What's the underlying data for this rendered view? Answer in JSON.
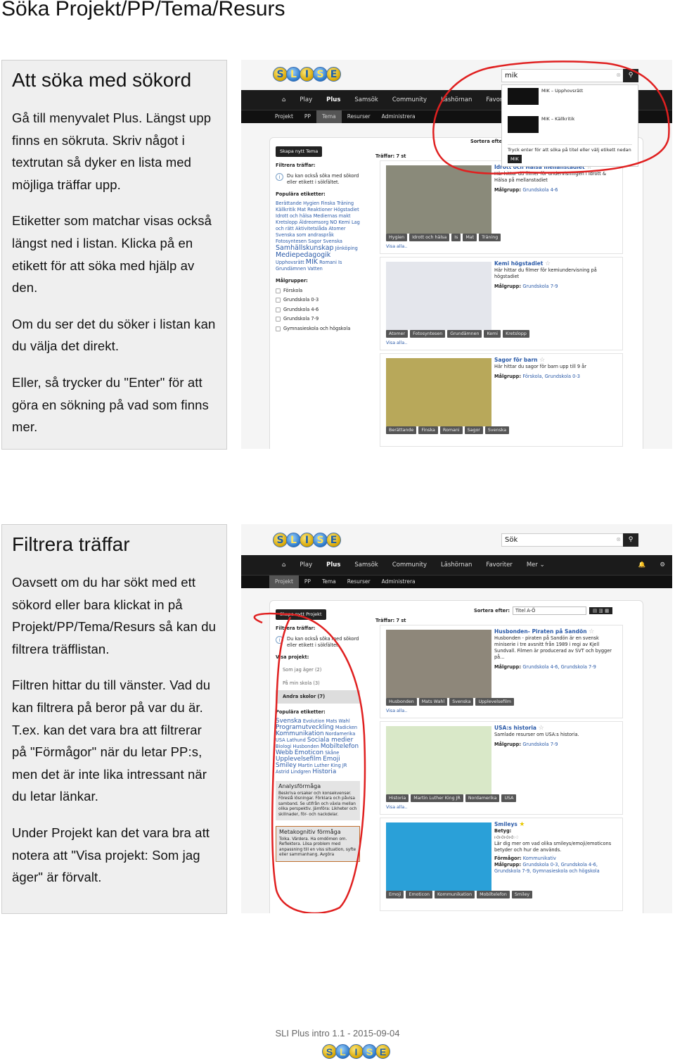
{
  "page_title": "Söka Projekt/PP/Tema/Resurs",
  "section1": {
    "heading": "Att söka med sökord",
    "paragraphs": [
      "Gå till menyvalet Plus. Längst upp finns en sökruta. Skriv något i textrutan så dyker en lista med möjliga träffar upp.",
      "Etiketter som matchar visas också längst ned i listan. Klicka på en etikett för att söka med hjälp av den.",
      "Om du ser det du söker i listan kan du välja det direkt.",
      "Eller, så trycker du \"Enter\" för att göra en sökning på vad som finns mer."
    ]
  },
  "section2": {
    "heading": "Filtrera träffar",
    "paragraphs": [
      "Oavsett om du har sökt med ett sökord eller bara klickat in på Projekt/PP/Tema/Resurs så kan du filtrera träfflistan.",
      "Filtren hittar du till vänster. Vad du kan filtrera på beror på var du är. T.ex. kan det vara bra att filtrerar på \"Förmågor\" när du letar PP:s, men det är inte lika intressant när du letar länkar.",
      "Under Projekt kan det vara bra att notera att \"Visa projekt: Som jag äger\" är förvalt."
    ]
  },
  "logo_letters": [
    "S",
    "L",
    "I",
    "S",
    "E"
  ],
  "nav": {
    "main": [
      "Play",
      "Plus",
      "Samsök",
      "Community",
      "Läshörnan",
      "Favoriter",
      "Mer ⌄"
    ],
    "active": "Plus",
    "sub": [
      "Projekt",
      "PP",
      "Tema",
      "Resurser",
      "Administrera"
    ]
  },
  "shot1": {
    "search_value": "mik",
    "active_sub": "Tema",
    "create_button": "Skapa nytt Tema",
    "dropdown": {
      "items": [
        "MIK – Upphovsrätt",
        "MIK – Källkritik"
      ],
      "hint": "Tryck enter för att söka på titel eller välj etikett nedan",
      "tag": "MIK"
    },
    "sort_label": "Sortera efter:",
    "filter_title": "Filtrera träffar:",
    "info": "Du kan också söka med sökord eller etikett i sökfältet.",
    "popular_title": "Populära etiketter:",
    "tags": [
      "Berättande",
      "Hygien",
      "Finska",
      "Träning",
      "Källkritik",
      "Mat",
      "Reaktioner",
      "Högstadiet",
      "Idrott och hälsa",
      "Mediernas makt",
      "Kretslopp",
      "Äldreomsorg",
      "NO",
      "Kemi",
      "Lag och rätt",
      "Aktivitetslåda",
      "Atomer",
      "Svenska som andraspråk",
      "Fotosyntesen",
      "Sagor",
      "Svenska",
      "Samhällskunskap",
      "Jönköping",
      "Mediepedagogik",
      "Upphovsrätt",
      "MIK",
      "Romani",
      "Is",
      "Grundämnen",
      "Vatten"
    ],
    "target_title": "Målgrupper:",
    "targets": [
      "Förskola",
      "Grundskola 0-3",
      "Grundskola 4-6",
      "Grundskola 7-9",
      "Gymnasieskola och högskola"
    ],
    "hits": "Träffar: 7 st",
    "results": [
      {
        "title": "Idrott och Hälsa mellanstadiet",
        "desc": "Här hittar du filmer för undervisningen i Idrott & Hälsa på mellanstadiet",
        "target": "Grundskola 4-6",
        "tags": [
          "Hygien",
          "Idrott och hälsa",
          "Is",
          "Mat",
          "Träning"
        ],
        "more": "Visa alla..",
        "color": "#8a8a7a"
      },
      {
        "title": "Kemi högstadiet",
        "desc": "Här hittar du filmer för kemiundervisning på högstadiet",
        "target": "Grundskola 7-9",
        "tags": [
          "Atomer",
          "Fotosyntesen",
          "Grundämnen",
          "Kemi",
          "Kretslopp"
        ],
        "more": "Visa alla..",
        "color": "#e4e6ec"
      },
      {
        "title": "Sagor för barn",
        "desc": "Här hittar du sagor för barn upp till 9 år",
        "target": "Förskola, Grundskola 0-3",
        "tags": [
          "Berättande",
          "Finska",
          "Romani",
          "Sagor",
          "Svenska"
        ],
        "more": "",
        "color": "#b8a85a"
      }
    ]
  },
  "shot2": {
    "search_placeholder": "Sök",
    "active_sub": "Projekt",
    "create_button": "Skapa nytt Projekt",
    "sort_label": "Sortera efter:",
    "sort_value": "Titel A-Ö",
    "filter_title": "Filtrera träffar:",
    "info": "Du kan också söka med sökord eller etikett i sökfältet.",
    "show_title": "Visa projekt:",
    "show_options": [
      "Som jag äger (2)",
      "På min skola (3)",
      "Andra skolor (7)"
    ],
    "show_selected": "Andra skolor (7)",
    "popular_title": "Populära etiketter:",
    "tags": [
      "Svenska",
      "Evolution",
      "Mats Wahl",
      "Programutveckling",
      "Madicken",
      "Kommunikation",
      "Nordamerika",
      "USA",
      "Lathund",
      "Sociala medier",
      "Biologi",
      "Husbonden",
      "Mobiltelefon",
      "Webb",
      "Emoticon",
      "Skåne",
      "Upplevelsefilm",
      "Emoji",
      "Smiley",
      "Martin Luther King JR",
      "Astrid Lindgren",
      "Historia"
    ],
    "abilities": [
      {
        "title": "Analysförmåga",
        "text": "Beskriva orsaker och konsekvenser. Föreslå lösningar. Förklara och påvisa samband. Se utifrån och växla mellan olika perspektiv. Jämföra: Likheter och skillnader, för- och nackdelar."
      },
      {
        "title": "Metakognitiv förmåga",
        "text": "Tolka. Värdera. Ha omdömen om. Reflektera. Lösa problem med anpassning till en viss situation, syfte eller sammanhang. Avgöra"
      }
    ],
    "hits": "Träffar: 7 st",
    "results": [
      {
        "title": "Husbonden- Piraten på Sandön",
        "desc": "Husbonden - piraten på Sandön är en svensk miniserie i tre avsnitt från 1989 i regi av Kjell Sundvall. Filmen är producerad av SVT och bygger på...",
        "target": "Grundskola 4-6, Grundskola 7-9",
        "tags": [
          "Husbonden",
          "Mats Wahl",
          "Svenska",
          "Upplevelsefilm"
        ],
        "more": "Visa alla..",
        "color": "#8e877a"
      },
      {
        "title": "USA:s historia",
        "desc": "Samlade resurser om USA:s historia.",
        "target": "Grundskola 7-9",
        "tags": [
          "Historia",
          "Martin Luther King JR",
          "Nordamerika",
          "USA"
        ],
        "more": "Visa alla..",
        "color": "#d9e8c8"
      },
      {
        "title": "Smileys",
        "rating_label": "Betyg:",
        "rating": 4,
        "rating_max": 5,
        "desc": "Lär dig mer om vad olika smileys/emoji/emoticons betyder och hur de används.",
        "abilities_label": "Förmågor:",
        "abilities": "Kommunikativ",
        "target": "Grundskola 0-3, Grundskola 4-6, Grundskola 7-9, Gymnasieskola och högskola",
        "tags": [
          "Emoji",
          "Emoticon",
          "Kommunikation",
          "Mobiltelefon",
          "Smiley"
        ],
        "more": "",
        "color": "#2aa0d8",
        "favorite": true
      }
    ]
  },
  "labels": {
    "target": "Målgrupp:"
  },
  "footer": "SLI Plus intro 1.1 - 2015-09-04",
  "colors": {
    "annotation": "#e02020",
    "link": "#2a5aa8",
    "nav": "#1b1b1b"
  }
}
